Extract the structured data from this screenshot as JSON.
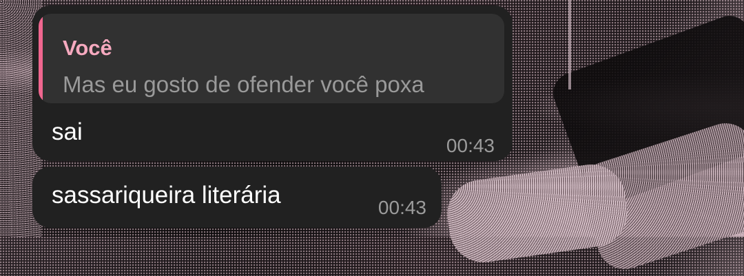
{
  "messages": [
    {
      "reply": {
        "author": "Você",
        "text": "Mas eu gosto de ofender você poxa"
      },
      "text": "sai",
      "time": "00:43"
    },
    {
      "text": "sassariqueira literária",
      "time": "00:43"
    }
  ],
  "colors": {
    "bubble": "#212121",
    "reply_box": "#313131",
    "reply_accent": "#f0668f",
    "reply_author": "#f6a9bf",
    "reply_text": "#9a9a9a",
    "message_text": "#ffffff",
    "timestamp": "#9b9b9b"
  }
}
